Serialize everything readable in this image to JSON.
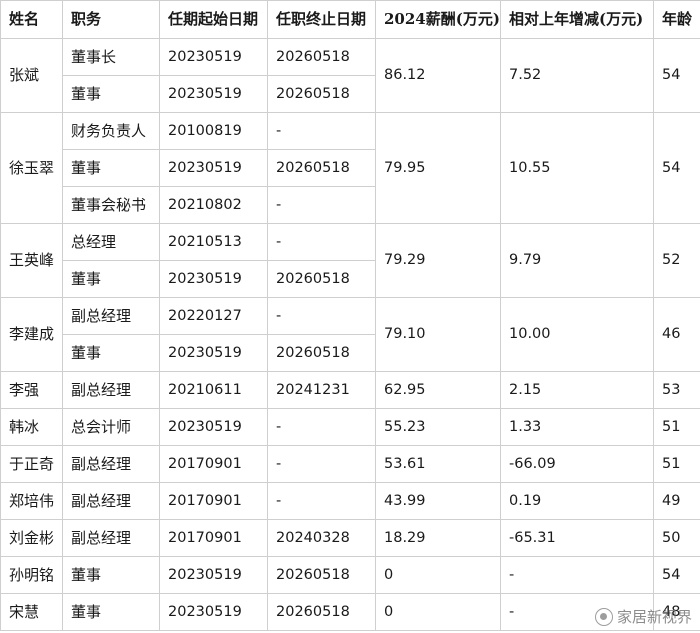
{
  "headers": [
    "姓名",
    "职务",
    "任期起始日期",
    "任职终止日期",
    "2024薪酬(万元)",
    "相对上年增减(万元)",
    "年龄"
  ],
  "people": [
    {
      "name": "张斌",
      "salary": "86.12",
      "change": "7.52",
      "age": "54",
      "roles": [
        {
          "title": "董事长",
          "start": "20230519",
          "end": "20260518"
        },
        {
          "title": "董事",
          "start": "20230519",
          "end": "20260518"
        }
      ]
    },
    {
      "name": "徐玉翠",
      "salary": "79.95",
      "change": "10.55",
      "age": "54",
      "roles": [
        {
          "title": "财务负责人",
          "start": "20100819",
          "end": "-"
        },
        {
          "title": "董事",
          "start": "20230519",
          "end": "20260518"
        },
        {
          "title": "董事会秘书",
          "start": "20210802",
          "end": "-"
        }
      ]
    },
    {
      "name": "王英峰",
      "salary": "79.29",
      "change": "9.79",
      "age": "52",
      "roles": [
        {
          "title": "总经理",
          "start": "20210513",
          "end": "-"
        },
        {
          "title": "董事",
          "start": "20230519",
          "end": "20260518"
        }
      ]
    },
    {
      "name": "李建成",
      "salary": "79.10",
      "change": "10.00",
      "age": "46",
      "roles": [
        {
          "title": "副总经理",
          "start": "20220127",
          "end": "-"
        },
        {
          "title": "董事",
          "start": "20230519",
          "end": "20260518"
        }
      ]
    },
    {
      "name": "李强",
      "salary": "62.95",
      "change": "2.15",
      "age": "53",
      "roles": [
        {
          "title": "副总经理",
          "start": "20210611",
          "end": "20241231"
        }
      ]
    },
    {
      "name": "韩冰",
      "salary": "55.23",
      "change": "1.33",
      "age": "51",
      "roles": [
        {
          "title": "总会计师",
          "start": "20230519",
          "end": "-"
        }
      ]
    },
    {
      "name": "于正奇",
      "salary": "53.61",
      "change": "-66.09",
      "age": "51",
      "roles": [
        {
          "title": "副总经理",
          "start": "20170901",
          "end": "-"
        }
      ]
    },
    {
      "name": "郑培伟",
      "salary": "43.99",
      "change": "0.19",
      "age": "49",
      "roles": [
        {
          "title": "副总经理",
          "start": "20170901",
          "end": "-"
        }
      ]
    },
    {
      "name": "刘金彬",
      "salary": "18.29",
      "change": "-65.31",
      "age": "50",
      "roles": [
        {
          "title": "副总经理",
          "start": "20170901",
          "end": "20240328"
        }
      ]
    },
    {
      "name": "孙明铭",
      "salary": "0",
      "change": "-",
      "age": "54",
      "roles": [
        {
          "title": "董事",
          "start": "20230519",
          "end": "20260518"
        }
      ]
    },
    {
      "name": "宋慧",
      "salary": "0",
      "change": "-",
      "age": "48",
      "roles": [
        {
          "title": "董事",
          "start": "20230519",
          "end": "20260518"
        }
      ]
    }
  ],
  "watermark": "家居新视界"
}
